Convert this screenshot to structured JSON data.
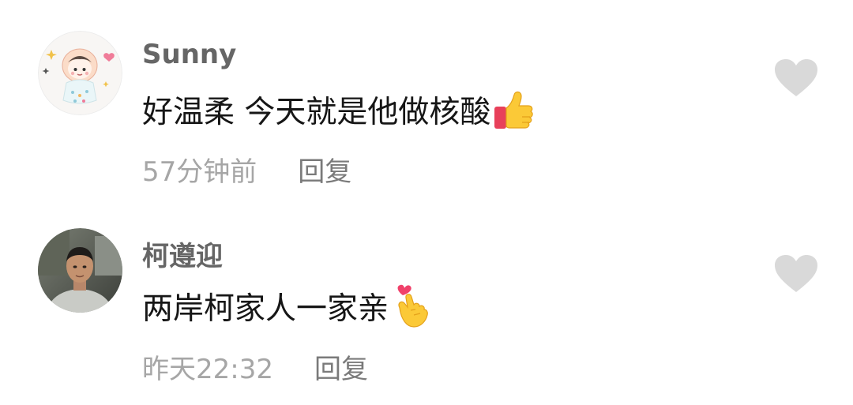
{
  "comments": [
    {
      "username": "Sunny",
      "text": "好温柔 今天就是他做核酸",
      "emoji": "thumbs-up-icon",
      "timestamp": "57分钟前",
      "reply_label": "回复",
      "avatar": "cartoon-character-avatar",
      "like_icon": "heart-icon"
    },
    {
      "username": "柯遵迎",
      "text": "两岸柯家人一家亲",
      "emoji": "finger-heart-icon",
      "timestamp": "昨天22:32",
      "reply_label": "回复",
      "avatar": "user-photo-avatar",
      "like_icon": "heart-icon"
    }
  ],
  "colors": {
    "username": "#666666",
    "text": "#161616",
    "timestamp": "#a6a6a6",
    "reply": "#7a7a7a",
    "heart": "#d9d9d9"
  }
}
